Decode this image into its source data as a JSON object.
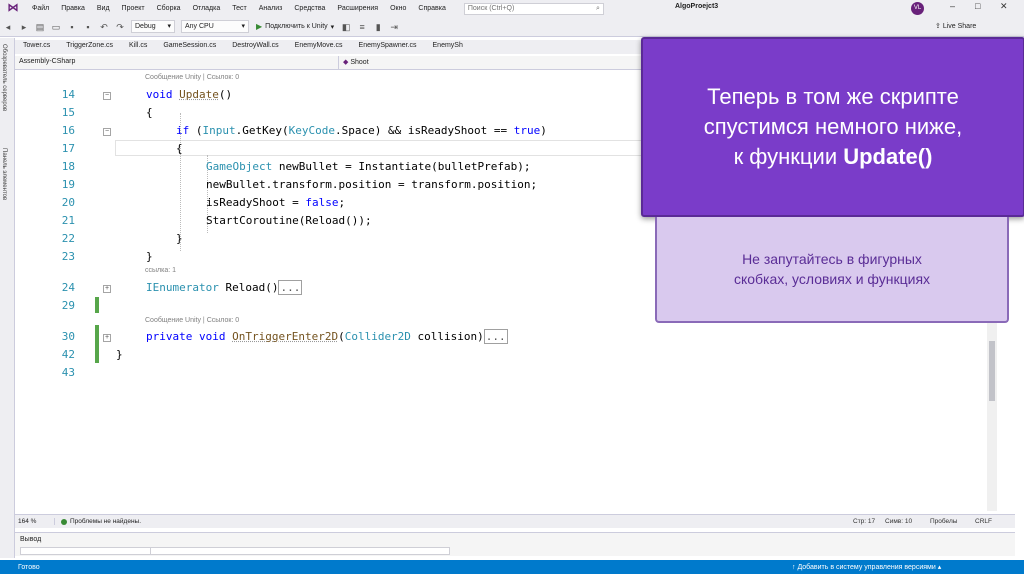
{
  "menubar": {
    "items": [
      "Файл",
      "Правка",
      "Вид",
      "Проект",
      "Сборка",
      "Отладка",
      "Тест",
      "Анализ",
      "Средства",
      "Расширения",
      "Окно",
      "Справка"
    ],
    "quick_launch_placeholder": "Поиск (Ctrl+Q)",
    "window_title": "AlgoProejct3",
    "user_initials": "VL"
  },
  "toolbar": {
    "config": "Debug",
    "platform": "Any CPU",
    "attach_label": "Подключить к Unity",
    "live_share": "Live Share"
  },
  "left_strip": {
    "server_explorer": "Обозреватель серверов",
    "toolbox": "Панель элементов"
  },
  "doc_tabs": [
    "Tower.cs",
    "TriggerZone.cs",
    "Kill.cs",
    "GameSession.cs",
    "DestroyWall.cs",
    "EnemyMove.cs",
    "EnemySpawner.cs",
    "EnemySh"
  ],
  "nav": {
    "project": "Assembly-CSharp",
    "member": "Shoot"
  },
  "code": {
    "lens_update": "Сообщение Unity | Ссылок: 0",
    "lens_reload": "ссылка: 1",
    "lens_trigger": "Сообщение Unity | Ссылок: 0",
    "line_numbers": [
      "14",
      "15",
      "16",
      "17",
      "18",
      "19",
      "20",
      "21",
      "22",
      "23",
      "24",
      "29",
      "30",
      "42",
      "43"
    ],
    "update_kw": "void",
    "update_name": "Update",
    "update_tail": "()",
    "brace_open": "{",
    "if_kw": "if",
    "if_input": "Input",
    "if_getkey": ".GetKey(",
    "if_keycode": "KeyCode",
    "if_space": ".Space) && isReadyShoot == ",
    "if_true": "true",
    "if_close": ")",
    "brace_inner_open": "{",
    "line18_type": "GameObject",
    "line18_rest": " newBullet = Instantiate(bulletPrefab);",
    "line19": "newBullet.transform.position = transform.position;",
    "line20_pre": "isReadyShoot = ",
    "line20_kw": "false",
    "line20_post": ";",
    "line21": "StartCoroutine(Reload());",
    "brace_inner_close": "}",
    "brace_close": "}",
    "reload_type": "IEnumerator",
    "reload_rest": " Reload()",
    "collapsed_marker": "...",
    "trigger_private": "private",
    "trigger_void": "void",
    "trigger_name": "OnTriggerEnter2D",
    "trigger_paren": "(",
    "trigger_type": "Collider2D",
    "trigger_rest": " collision)",
    "class_close": "}"
  },
  "status_strip": {
    "zoom": "164 %",
    "issues": "Проблемы не найдены.",
    "line": "Стр: 17",
    "col": "Симв: 10",
    "spaces": "Пробелы",
    "eol": "CRLF"
  },
  "output": {
    "title": "Вывод"
  },
  "statusbar": {
    "ready": "Готово",
    "scm": "Добавить в систему управления версиями"
  },
  "overlay": {
    "line1": "Теперь в том же скрипте",
    "line2": "спустимся немного ниже,",
    "line3_prefix": "к функции ",
    "line3_bold": "Update()"
  },
  "hint": {
    "line1": "Не запутайтесь в фигурных",
    "line2": "скобках, условиях и функциях"
  },
  "colors": {
    "accent": "#007acc",
    "overlay": "#7a3cc9",
    "hint_bg": "#d9c9ee",
    "keyword": "#0000ff",
    "type": "#2b91af"
  }
}
